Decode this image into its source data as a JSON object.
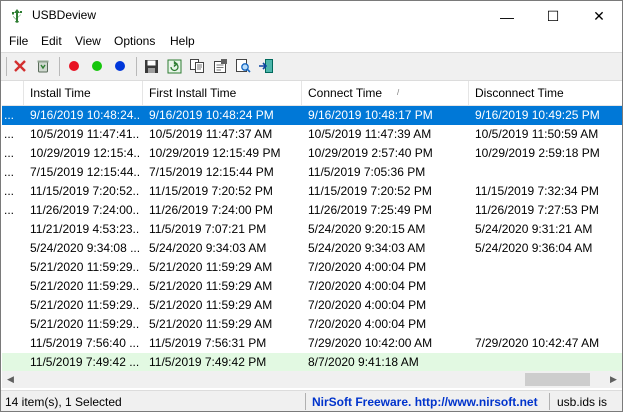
{
  "window": {
    "title": "USBDeview"
  },
  "titlebar": {
    "minimize": "—",
    "maximize": "☐",
    "close": "✕"
  },
  "menu": [
    "File",
    "Edit",
    "View",
    "Options",
    "Help"
  ],
  "toolbar": {
    "icons": [
      "delete-icon",
      "recycle-icon",
      "red-dot-icon",
      "green-dot-icon",
      "blue-dot-icon",
      "save-icon",
      "refresh-icon",
      "copy-icon",
      "properties-icon",
      "find-icon",
      "exit-icon"
    ],
    "colors": {
      "red": "#e81123",
      "green": "#16c60c",
      "blue": "#0037da"
    }
  },
  "columns": [
    "Install Time",
    "First Install Time",
    "Connect Time",
    "Disconnect Time"
  ],
  "sort_indicator": "/",
  "rows": [
    {
      "lead": "...",
      "install": "9/16/2019 10:48:24...",
      "first": "9/16/2019 10:48:24 PM",
      "connect": "9/16/2019 10:48:17 PM",
      "disconnect": "9/16/2019 10:49:25 PM",
      "state": "selected"
    },
    {
      "lead": "...",
      "install": "10/5/2019 11:47:41...",
      "first": "10/5/2019 11:47:37 AM",
      "connect": "10/5/2019 11:47:39 AM",
      "disconnect": "10/5/2019 11:50:59 AM",
      "state": ""
    },
    {
      "lead": "...",
      "install": "10/29/2019 12:15:4...",
      "first": "10/29/2019 12:15:49 PM",
      "connect": "10/29/2019 2:57:40 PM",
      "disconnect": "10/29/2019 2:59:18 PM",
      "state": ""
    },
    {
      "lead": "...",
      "install": "7/15/2019 12:15:44...",
      "first": "7/15/2019 12:15:44 PM",
      "connect": "11/5/2019 7:05:36 PM",
      "disconnect": "",
      "state": ""
    },
    {
      "lead": "...",
      "install": "11/15/2019 7:20:52...",
      "first": "11/15/2019 7:20:52 PM",
      "connect": "11/15/2019 7:20:52 PM",
      "disconnect": "11/15/2019 7:32:34 PM",
      "state": ""
    },
    {
      "lead": "...",
      "install": "11/26/2019 7:24:00...",
      "first": "11/26/2019 7:24:00 PM",
      "connect": "11/26/2019 7:25:49 PM",
      "disconnect": "11/26/2019 7:27:53 PM",
      "state": ""
    },
    {
      "lead": "",
      "install": "11/21/2019 4:53:23...",
      "first": "11/5/2019 7:07:21 PM",
      "connect": "5/24/2020 9:20:15 AM",
      "disconnect": "5/24/2020 9:31:21 AM",
      "state": ""
    },
    {
      "lead": "",
      "install": "5/24/2020 9:34:08 ...",
      "first": "5/24/2020 9:34:03 AM",
      "connect": "5/24/2020 9:34:03 AM",
      "disconnect": "5/24/2020 9:36:04 AM",
      "state": ""
    },
    {
      "lead": "",
      "install": "5/21/2020 11:59:29...",
      "first": "5/21/2020 11:59:29 AM",
      "connect": "7/20/2020 4:00:04 PM",
      "disconnect": "",
      "state": ""
    },
    {
      "lead": "",
      "install": "5/21/2020 11:59:29...",
      "first": "5/21/2020 11:59:29 AM",
      "connect": "7/20/2020 4:00:04 PM",
      "disconnect": "",
      "state": ""
    },
    {
      "lead": "",
      "install": "5/21/2020 11:59:29...",
      "first": "5/21/2020 11:59:29 AM",
      "connect": "7/20/2020 4:00:04 PM",
      "disconnect": "",
      "state": ""
    },
    {
      "lead": "",
      "install": "5/21/2020 11:59:29...",
      "first": "5/21/2020 11:59:29 AM",
      "connect": "7/20/2020 4:00:04 PM",
      "disconnect": "",
      "state": ""
    },
    {
      "lead": "",
      "install": "11/5/2019 7:56:40 ...",
      "first": "11/5/2019 7:56:31 PM",
      "connect": "7/29/2020 10:42:00 AM",
      "disconnect": "7/29/2020 10:42:47 AM",
      "state": ""
    },
    {
      "lead": "",
      "install": "11/5/2019 7:49:42 ...",
      "first": "11/5/2019 7:49:42 PM",
      "connect": "8/7/2020 9:41:18 AM",
      "disconnect": "",
      "state": "connected"
    }
  ],
  "scrollbar": {
    "left": "◀",
    "right": "▶"
  },
  "status": {
    "count": "14 item(s), 1 Selected",
    "link": "NirSoft Freeware.  http://www.nirsoft.net",
    "usbids": "usb.ids is"
  }
}
